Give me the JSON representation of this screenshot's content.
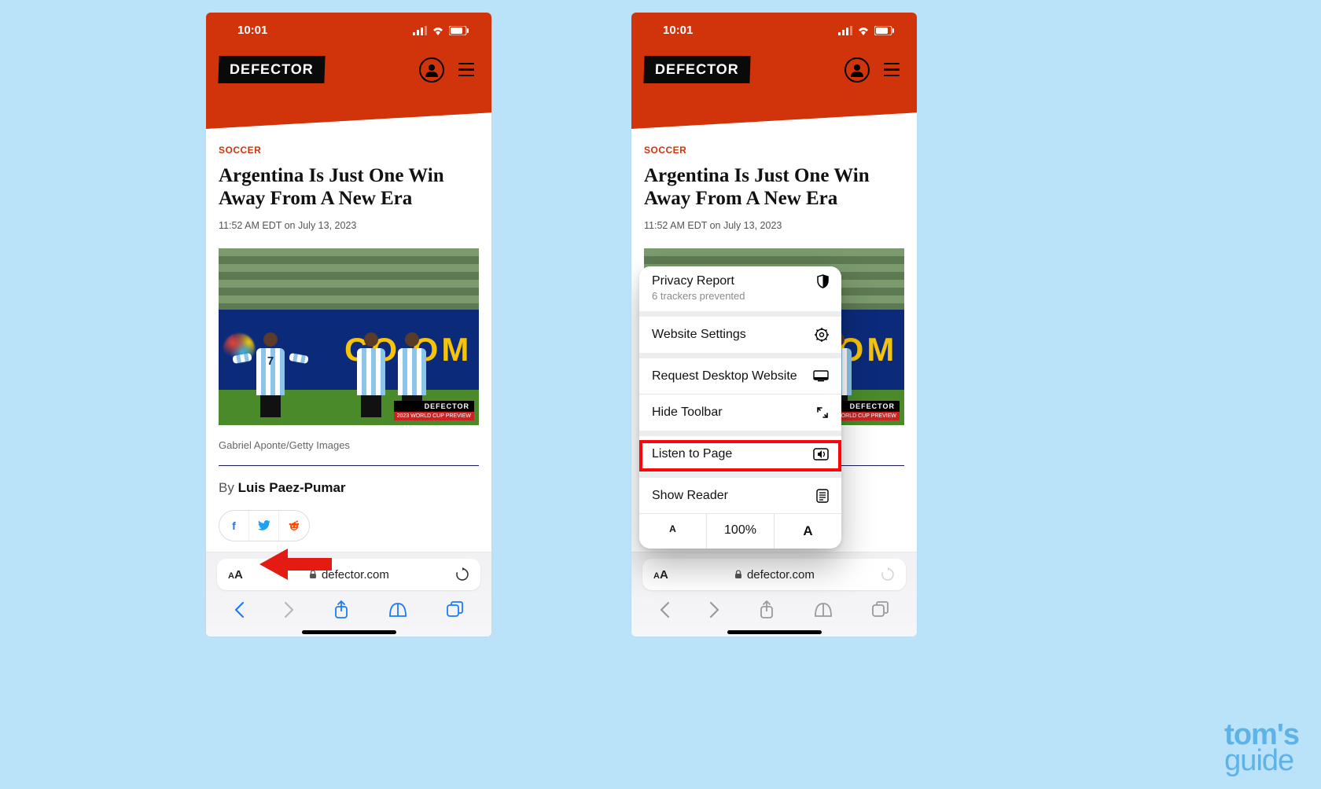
{
  "status": {
    "time": "10:01"
  },
  "site": {
    "logo_text": "DEFECTOR",
    "category": "SOCCER",
    "headline": "Argentina Is Just One Win Away From A New Era",
    "timestamp": "11:52 AM EDT on July 13, 2023",
    "hero_badge": "DEFECTOR",
    "hero_badge_sub": "2023 WORLD CUP PREVIEW",
    "caption": "Gabriel Aponte/Getty Images",
    "byline_prefix": "By ",
    "byline_name": "Luis Paez-Pumar",
    "ad_text": "CO    OM",
    "player_numbers": [
      "7",
      "",
      ""
    ]
  },
  "safari": {
    "aa_small": "A",
    "aa_big": "A",
    "url": "defector.com"
  },
  "menu": {
    "privacy_title": "Privacy Report",
    "privacy_sub": "6 trackers prevented",
    "website_settings": "Website Settings",
    "request_desktop": "Request Desktop Website",
    "hide_toolbar": "Hide Toolbar",
    "listen": "Listen to Page",
    "show_reader": "Show Reader",
    "zoom_small": "A",
    "zoom_value": "100%",
    "zoom_big": "A"
  },
  "watermark": {
    "line1": "tom's",
    "line2": "guide"
  }
}
